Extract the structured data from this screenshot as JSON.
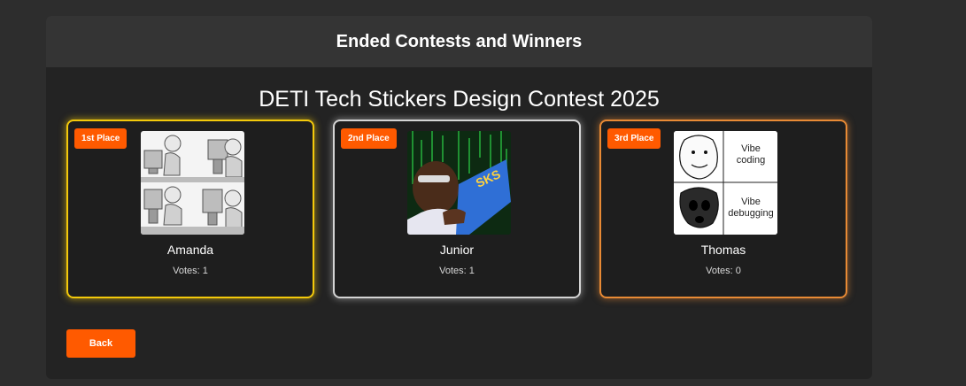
{
  "header": {
    "title": "Ended Contests and Winners"
  },
  "contest": {
    "title": "DETI Tech Stickers Design Contest 2025",
    "winners": [
      {
        "place": "1st Place",
        "name": "Amanda",
        "votes": "Votes: 1",
        "accent": "#f3c90b",
        "icon": "meme-computer-guys-image"
      },
      {
        "place": "2nd Place",
        "name": "Junior",
        "votes": "Votes: 1",
        "accent": "#d4d4d4",
        "icon": "hacker-kid-image"
      },
      {
        "place": "3rd Place",
        "name": "Thomas",
        "votes": "Votes: 0",
        "accent": "#e88a35",
        "icon": "vibe-meme-image",
        "meme_text": {
          "top": "Vibe coding",
          "bottom": "Vibe debugging"
        }
      }
    ]
  },
  "actions": {
    "back_label": "Back"
  },
  "colors": {
    "accent": "#ff5a00",
    "panel": "#232323",
    "header": "#343434",
    "background": "#2d2d2d"
  }
}
